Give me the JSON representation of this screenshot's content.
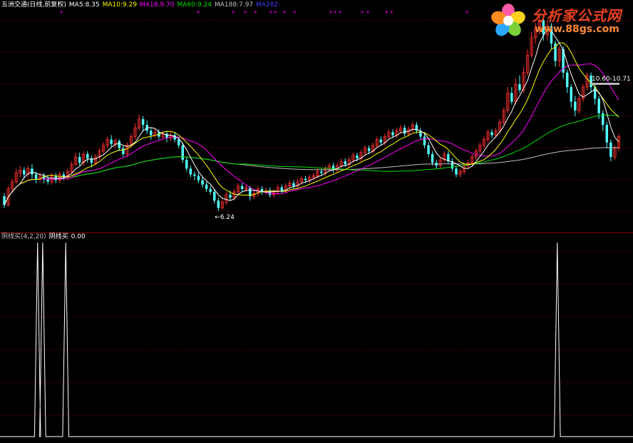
{
  "header": {
    "stock_label": "五洲交通(日线,前复权)",
    "ma_labels": [
      {
        "text": "MA5:8.35",
        "color": "#ffffff"
      },
      {
        "text": "MA10:9.29",
        "color": "#ffff00"
      },
      {
        "text": "MA18:9.70",
        "color": "#ff00ff"
      },
      {
        "text": "MA60:9.24",
        "color": "#00e000"
      },
      {
        "text": "MA188:7.97",
        "color": "#c0c0c0"
      },
      {
        "text": "MA282:",
        "color": "#4040ff"
      }
    ]
  },
  "indicator_header": {
    "name": "阴线买(4,2,20)",
    "value_label": "阴线买",
    "value": "0.00"
  },
  "logo": {
    "title": "分析家公式网",
    "url": "www.88gs.com"
  },
  "colors": {
    "background": "#000000",
    "grid": "#7a0000",
    "panel_border": "#a00000",
    "up_candle": "#ff3030",
    "down_candle": "#54ffff",
    "ma5": "#ffffff",
    "ma10": "#ffff00",
    "ma18": "#ff00ff",
    "ma60": "#00e000",
    "ma188": "#c0c0c0",
    "signal_mark": "#ff00ff",
    "indicator_line": "#ffffff"
  },
  "chart_data": [
    {
      "type": "candlestick",
      "title": "五洲交通(日线,前复权)",
      "ylim": [
        5.6,
        13.2
      ],
      "low_annotation": {
        "label": "←6.24",
        "value": 6.24
      },
      "high_annotation": {
        "label": "10.60-10.71",
        "value": 10.65
      },
      "signal_marks": {
        "symbol": "×",
        "count": 17
      },
      "candles": [
        [
          6.75,
          6.45,
          6.85,
          6.35
        ],
        [
          6.45,
          7.0,
          7.1,
          6.4
        ],
        [
          7.0,
          7.25,
          7.35,
          6.9
        ],
        [
          7.25,
          7.55,
          7.7,
          7.15
        ],
        [
          7.55,
          7.65,
          7.8,
          7.4
        ],
        [
          7.65,
          7.5,
          7.75,
          7.35
        ],
        [
          7.5,
          7.7,
          7.8,
          7.4
        ],
        [
          7.7,
          7.5,
          7.85,
          7.35
        ],
        [
          7.5,
          7.35,
          7.6,
          7.2
        ],
        [
          7.35,
          7.45,
          7.55,
          7.25
        ],
        [
          7.45,
          7.35,
          7.55,
          7.2
        ],
        [
          7.35,
          7.25,
          7.45,
          7.15
        ],
        [
          7.25,
          7.45,
          7.55,
          7.15
        ],
        [
          7.45,
          7.3,
          7.55,
          7.2
        ],
        [
          7.3,
          7.5,
          7.6,
          7.2
        ],
        [
          7.5,
          7.4,
          7.6,
          7.3
        ],
        [
          7.4,
          7.6,
          7.7,
          7.3
        ],
        [
          7.6,
          7.85,
          7.95,
          7.5
        ],
        [
          7.85,
          8.1,
          8.25,
          7.8
        ],
        [
          8.1,
          7.9,
          8.25,
          7.8
        ],
        [
          7.9,
          8.2,
          8.3,
          7.8
        ],
        [
          8.2,
          8.05,
          8.3,
          7.9
        ],
        [
          8.05,
          7.9,
          8.15,
          7.75
        ],
        [
          7.9,
          8.1,
          8.2,
          7.8
        ],
        [
          8.1,
          8.3,
          8.4,
          8.0
        ],
        [
          8.3,
          8.5,
          8.6,
          8.2
        ],
        [
          8.5,
          8.7,
          8.8,
          8.4
        ],
        [
          8.7,
          8.55,
          8.85,
          8.45
        ],
        [
          8.55,
          8.65,
          8.75,
          8.4
        ],
        [
          8.65,
          8.4,
          8.7,
          8.3
        ],
        [
          8.4,
          8.2,
          8.5,
          8.1
        ],
        [
          8.2,
          8.5,
          8.6,
          8.1
        ],
        [
          8.5,
          8.8,
          8.9,
          8.4
        ],
        [
          8.8,
          9.1,
          9.25,
          8.7
        ],
        [
          9.1,
          9.4,
          9.55,
          9.0
        ],
        [
          9.4,
          9.2,
          9.5,
          9.0
        ],
        [
          9.2,
          9.0,
          9.35,
          8.9
        ],
        [
          9.0,
          8.85,
          9.1,
          8.7
        ],
        [
          8.85,
          8.95,
          9.05,
          8.75
        ],
        [
          8.95,
          8.8,
          9.05,
          8.7
        ],
        [
          8.8,
          8.9,
          9.0,
          8.7
        ],
        [
          8.9,
          8.75,
          9.0,
          8.6
        ],
        [
          8.75,
          8.85,
          8.95,
          8.65
        ],
        [
          8.85,
          8.7,
          8.95,
          8.6
        ],
        [
          8.7,
          8.5,
          8.8,
          8.4
        ],
        [
          8.5,
          8.0,
          8.6,
          7.9
        ],
        [
          8.0,
          7.7,
          8.1,
          7.6
        ],
        [
          7.7,
          7.5,
          7.8,
          7.4
        ],
        [
          7.5,
          7.45,
          7.6,
          7.3
        ],
        [
          7.45,
          7.3,
          7.55,
          7.2
        ],
        [
          7.3,
          7.15,
          7.45,
          7.05
        ],
        [
          7.15,
          7.0,
          7.25,
          6.9
        ],
        [
          7.0,
          6.9,
          7.1,
          6.8
        ],
        [
          6.9,
          6.6,
          7.0,
          6.5
        ],
        [
          6.6,
          6.35,
          6.7,
          6.24
        ],
        [
          6.35,
          6.55,
          6.65,
          6.3
        ],
        [
          6.55,
          6.8,
          6.9,
          6.45
        ],
        [
          6.8,
          6.7,
          6.95,
          6.6
        ],
        [
          6.7,
          6.9,
          7.0,
          6.6
        ],
        [
          6.9,
          7.1,
          7.2,
          6.8
        ],
        [
          7.1,
          7.0,
          7.2,
          6.9
        ],
        [
          7.0,
          7.05,
          7.15,
          6.9
        ],
        [
          7.05,
          6.75,
          7.1,
          6.6
        ],
        [
          6.75,
          6.85,
          6.95,
          6.65
        ],
        [
          6.85,
          7.0,
          7.1,
          6.75
        ],
        [
          7.0,
          6.9,
          7.1,
          6.8
        ],
        [
          6.9,
          6.95,
          7.05,
          6.8
        ],
        [
          6.95,
          6.8,
          7.05,
          6.7
        ],
        [
          6.8,
          6.9,
          7.0,
          6.7
        ],
        [
          6.9,
          7.05,
          7.15,
          6.8
        ],
        [
          7.05,
          6.95,
          7.15,
          6.85
        ],
        [
          6.95,
          7.1,
          7.2,
          6.85
        ],
        [
          7.1,
          7.2,
          7.3,
          7.0
        ],
        [
          7.2,
          7.1,
          7.3,
          7.0
        ],
        [
          7.1,
          7.25,
          7.35,
          7.0
        ],
        [
          7.25,
          7.35,
          7.45,
          7.15
        ],
        [
          7.35,
          7.3,
          7.45,
          7.2
        ],
        [
          7.3,
          7.4,
          7.5,
          7.2
        ],
        [
          7.4,
          7.45,
          7.55,
          7.3
        ],
        [
          7.45,
          7.6,
          7.7,
          7.35
        ],
        [
          7.6,
          7.55,
          7.7,
          7.45
        ],
        [
          7.55,
          7.7,
          7.8,
          7.45
        ],
        [
          7.7,
          7.8,
          7.9,
          7.6
        ],
        [
          7.8,
          7.65,
          7.9,
          7.55
        ],
        [
          7.65,
          7.8,
          7.9,
          7.55
        ],
        [
          7.8,
          7.95,
          8.05,
          7.7
        ],
        [
          7.95,
          7.85,
          8.05,
          7.75
        ],
        [
          7.85,
          8.0,
          8.1,
          7.75
        ],
        [
          8.0,
          8.15,
          8.25,
          7.9
        ],
        [
          8.15,
          8.05,
          8.25,
          7.95
        ],
        [
          8.05,
          8.25,
          8.35,
          7.95
        ],
        [
          8.25,
          8.4,
          8.5,
          8.15
        ],
        [
          8.4,
          8.3,
          8.5,
          8.2
        ],
        [
          8.3,
          8.5,
          8.6,
          8.2
        ],
        [
          8.5,
          8.7,
          8.8,
          8.4
        ],
        [
          8.7,
          8.6,
          8.8,
          8.5
        ],
        [
          8.6,
          8.8,
          8.9,
          8.5
        ],
        [
          8.8,
          8.95,
          9.05,
          8.7
        ],
        [
          8.95,
          8.85,
          9.05,
          8.75
        ],
        [
          8.85,
          9.0,
          9.1,
          8.75
        ],
        [
          9.0,
          9.1,
          9.2,
          8.9
        ],
        [
          9.1,
          8.9,
          9.2,
          8.8
        ],
        [
          8.9,
          9.05,
          9.15,
          8.8
        ],
        [
          9.05,
          9.2,
          9.3,
          8.95
        ],
        [
          9.2,
          9.0,
          9.3,
          8.9
        ],
        [
          9.0,
          8.8,
          9.1,
          8.7
        ],
        [
          8.8,
          8.5,
          8.9,
          8.4
        ],
        [
          8.5,
          8.2,
          8.6,
          8.1
        ],
        [
          8.2,
          7.9,
          8.3,
          7.8
        ],
        [
          7.9,
          7.8,
          8.0,
          7.7
        ],
        [
          7.8,
          8.0,
          8.1,
          7.7
        ],
        [
          8.0,
          8.2,
          8.3,
          7.9
        ],
        [
          8.2,
          7.95,
          8.3,
          7.85
        ],
        [
          7.95,
          7.7,
          8.05,
          7.6
        ],
        [
          7.7,
          7.5,
          7.8,
          7.4
        ],
        [
          7.5,
          7.6,
          7.7,
          7.4
        ],
        [
          7.6,
          7.8,
          7.9,
          7.5
        ],
        [
          7.8,
          7.9,
          8.0,
          7.7
        ],
        [
          7.9,
          8.1,
          8.2,
          7.8
        ],
        [
          8.1,
          8.3,
          8.4,
          8.0
        ],
        [
          8.3,
          8.5,
          8.6,
          8.2
        ],
        [
          8.5,
          8.7,
          8.8,
          8.4
        ],
        [
          8.7,
          8.95,
          9.05,
          8.6
        ],
        [
          8.95,
          8.85,
          9.05,
          8.75
        ],
        [
          8.85,
          9.0,
          9.1,
          8.75
        ],
        [
          9.0,
          9.3,
          9.4,
          8.9
        ],
        [
          9.3,
          9.7,
          9.8,
          9.2
        ],
        [
          9.7,
          10.3,
          10.5,
          9.6
        ],
        [
          10.3,
          10.0,
          10.5,
          9.9
        ],
        [
          10.0,
          10.6,
          10.8,
          9.9
        ],
        [
          10.6,
          10.4,
          10.9,
          10.3
        ],
        [
          10.4,
          11.0,
          11.2,
          10.3
        ],
        [
          11.0,
          11.6,
          11.8,
          10.9
        ],
        [
          11.6,
          12.2,
          12.4,
          11.5
        ],
        [
          12.2,
          12.5,
          12.7,
          12.0
        ],
        [
          12.5,
          12.8,
          13.05,
          12.3
        ],
        [
          12.8,
          12.3,
          12.9,
          12.1
        ],
        [
          12.3,
          12.6,
          12.8,
          12.1
        ],
        [
          12.6,
          12.0,
          12.7,
          11.8
        ],
        [
          12.0,
          11.4,
          12.1,
          11.2
        ],
        [
          11.4,
          11.8,
          11.9,
          11.2
        ],
        [
          11.8,
          11.0,
          11.9,
          10.8
        ],
        [
          11.0,
          10.5,
          11.1,
          10.3
        ],
        [
          10.5,
          10.0,
          10.6,
          9.8
        ],
        [
          10.0,
          9.7,
          10.2,
          9.5
        ],
        [
          9.7,
          10.1,
          10.2,
          9.6
        ],
        [
          10.1,
          10.5,
          10.6,
          10.0
        ],
        [
          10.5,
          10.9,
          11.0,
          10.4
        ],
        [
          10.9,
          10.5,
          11.0,
          10.3
        ],
        [
          10.5,
          10.1,
          10.6,
          9.9
        ],
        [
          10.1,
          9.6,
          10.2,
          9.4
        ],
        [
          9.6,
          9.2,
          9.7,
          9.0
        ],
        [
          9.2,
          8.6,
          9.3,
          8.4
        ],
        [
          8.6,
          8.1,
          8.7,
          7.95
        ],
        [
          8.1,
          8.4,
          8.5,
          8.0
        ],
        [
          8.4,
          8.8,
          8.9,
          8.3
        ]
      ]
    },
    {
      "type": "line",
      "title": "阴线买(4,2,20)",
      "ylim": [
        0,
        1
      ],
      "series": [
        {
          "name": "阴线买",
          "spikes": [
            13,
            15,
            24,
            216
          ],
          "spike_value": 1,
          "base": 0
        }
      ],
      "total_points": 241
    }
  ]
}
